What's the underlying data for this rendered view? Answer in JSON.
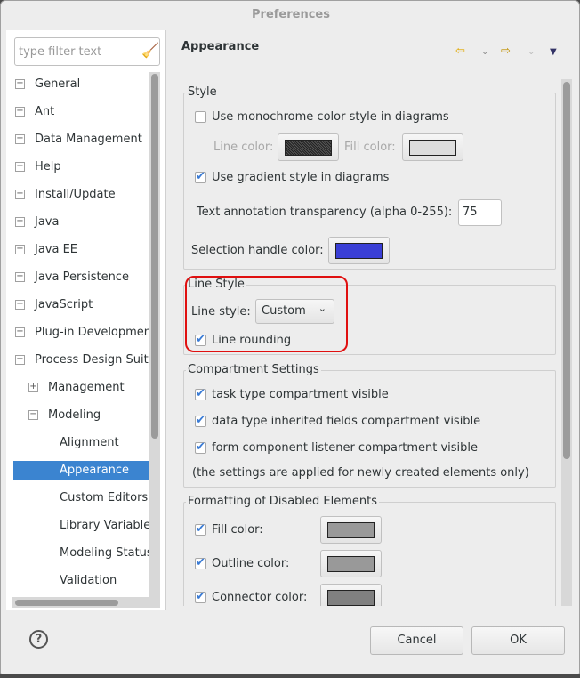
{
  "window": {
    "title": "Preferences"
  },
  "filter": {
    "placeholder": "type filter text",
    "icon": "broom-clear-icon"
  },
  "tree": [
    {
      "label": "General",
      "expander": "+"
    },
    {
      "label": "Ant",
      "expander": "+"
    },
    {
      "label": "Data Management",
      "expander": "+"
    },
    {
      "label": "Help",
      "expander": "+"
    },
    {
      "label": "Install/Update",
      "expander": "+"
    },
    {
      "label": "Java",
      "expander": "+"
    },
    {
      "label": "Java EE",
      "expander": "+"
    },
    {
      "label": "Java Persistence",
      "expander": "+"
    },
    {
      "label": "JavaScript",
      "expander": "+"
    },
    {
      "label": "Plug-in Development",
      "expander": "+"
    },
    {
      "label": "Process Design Suite",
      "expander": "−"
    },
    {
      "label": "Management",
      "expander": "+"
    },
    {
      "label": "Modeling",
      "expander": "−"
    },
    {
      "label": "Alignment"
    },
    {
      "label": "Appearance",
      "selected": true
    },
    {
      "label": "Custom Editors"
    },
    {
      "label": "Library Variables"
    },
    {
      "label": "Modeling Status"
    },
    {
      "label": "Validation"
    }
  ],
  "page": {
    "title": "Appearance",
    "style": {
      "legend": "Style",
      "monochrome": "Use monochrome color style in diagrams",
      "monochrome_checked": false,
      "line_color_label": "Line color:",
      "fill_color_label": "Fill color:",
      "line_color": "#333333",
      "fill_color": "#dddddd",
      "gradient": "Use gradient style in diagrams",
      "gradient_checked": true,
      "transparency_label": "Text annotation transparency (alpha 0-255):",
      "transparency_value": "75",
      "handle_label": "Selection handle color:",
      "handle_color": "#3a3fd6"
    },
    "line_style": {
      "legend": "Line Style",
      "label": "Line style:",
      "value": "Custom",
      "rounding": "Line rounding",
      "rounding_checked": true
    },
    "compartment": {
      "legend": "Compartment Settings",
      "items": [
        "task type compartment visible",
        "data type inherited fields compartment visible",
        "form component listener compartment visible"
      ],
      "note": "(the settings are applied for newly created elements only)"
    },
    "disabled": {
      "legend": "Formatting of Disabled Elements",
      "items": [
        {
          "label": "Fill color:",
          "color": "#999999"
        },
        {
          "label": "Outline color:",
          "color": "#999999"
        },
        {
          "label": "Connector color:",
          "color": "#808080"
        }
      ]
    }
  },
  "buttons": {
    "cancel": "Cancel",
    "ok": "OK",
    "help": "?"
  }
}
